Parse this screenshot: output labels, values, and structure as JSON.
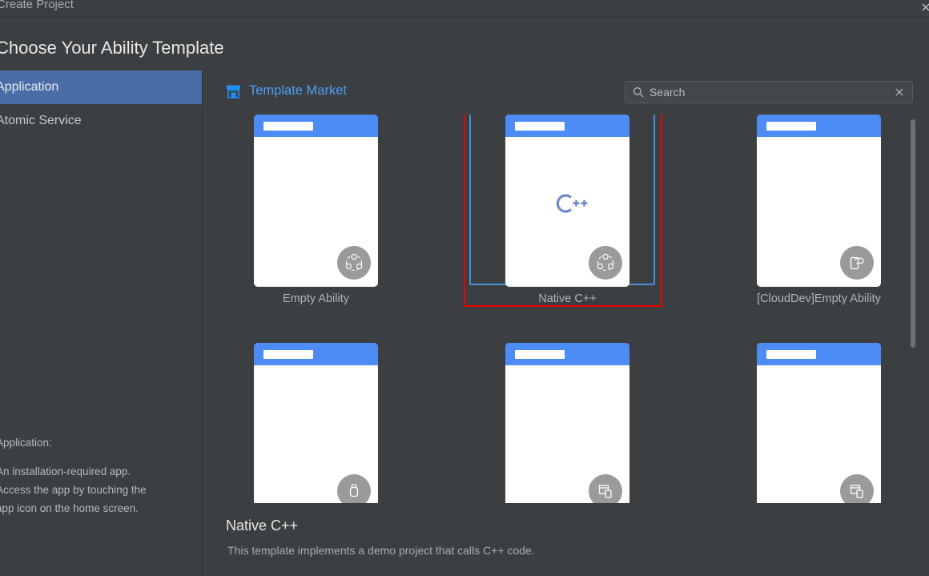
{
  "window": {
    "title": "Create Project",
    "close_icon": "close-icon"
  },
  "headline": "Choose Your Ability Template",
  "sidebar": {
    "items": [
      {
        "label": "Application",
        "selected": true
      },
      {
        "label": "Atomic Service",
        "selected": false
      }
    ],
    "description": {
      "heading": "Application:",
      "lines": [
        "An installation-required app.",
        "Access the app by touching the",
        "app icon on the home screen."
      ]
    }
  },
  "main": {
    "market_link": {
      "label": "Template Market",
      "icon": "storefront-icon"
    },
    "search": {
      "placeholder": "Search",
      "value": "",
      "icon": "search-icon",
      "clear_icon": "close-icon"
    },
    "templates": [
      {
        "label": "Empty Ability",
        "badge_icon": "network-nodes-icon",
        "logo": "",
        "selected": false,
        "annotated": false
      },
      {
        "label": "Native C++",
        "badge_icon": "network-nodes-icon",
        "logo": "cpp-logo",
        "selected": true,
        "annotated": true
      },
      {
        "label": "[CloudDev]Empty Ability",
        "badge_icon": "phone-cloud-icon",
        "logo": "",
        "selected": false,
        "annotated": false
      },
      {
        "label": "",
        "badge_icon": "watch-icon",
        "logo": "",
        "selected": false,
        "annotated": false
      },
      {
        "label": "",
        "badge_icon": "network-nodes-icon",
        "logo": "",
        "selected": false,
        "annotated": false
      },
      {
        "label": "",
        "badge_icon": "multi-device-icon",
        "logo": "",
        "selected": false,
        "annotated": false
      }
    ]
  },
  "details": {
    "title": "Native C++",
    "description": "This template implements a demo project that calls C++ code."
  },
  "colors": {
    "background": "#3c3f41",
    "accent_blue": "#4d8bf5",
    "link_blue": "#4d9ef5",
    "selection_blue": "#4a6da7",
    "selection_border": "#4a90d9",
    "annotation_red": "#f00000",
    "badge_gray": "#9a9a9a"
  }
}
